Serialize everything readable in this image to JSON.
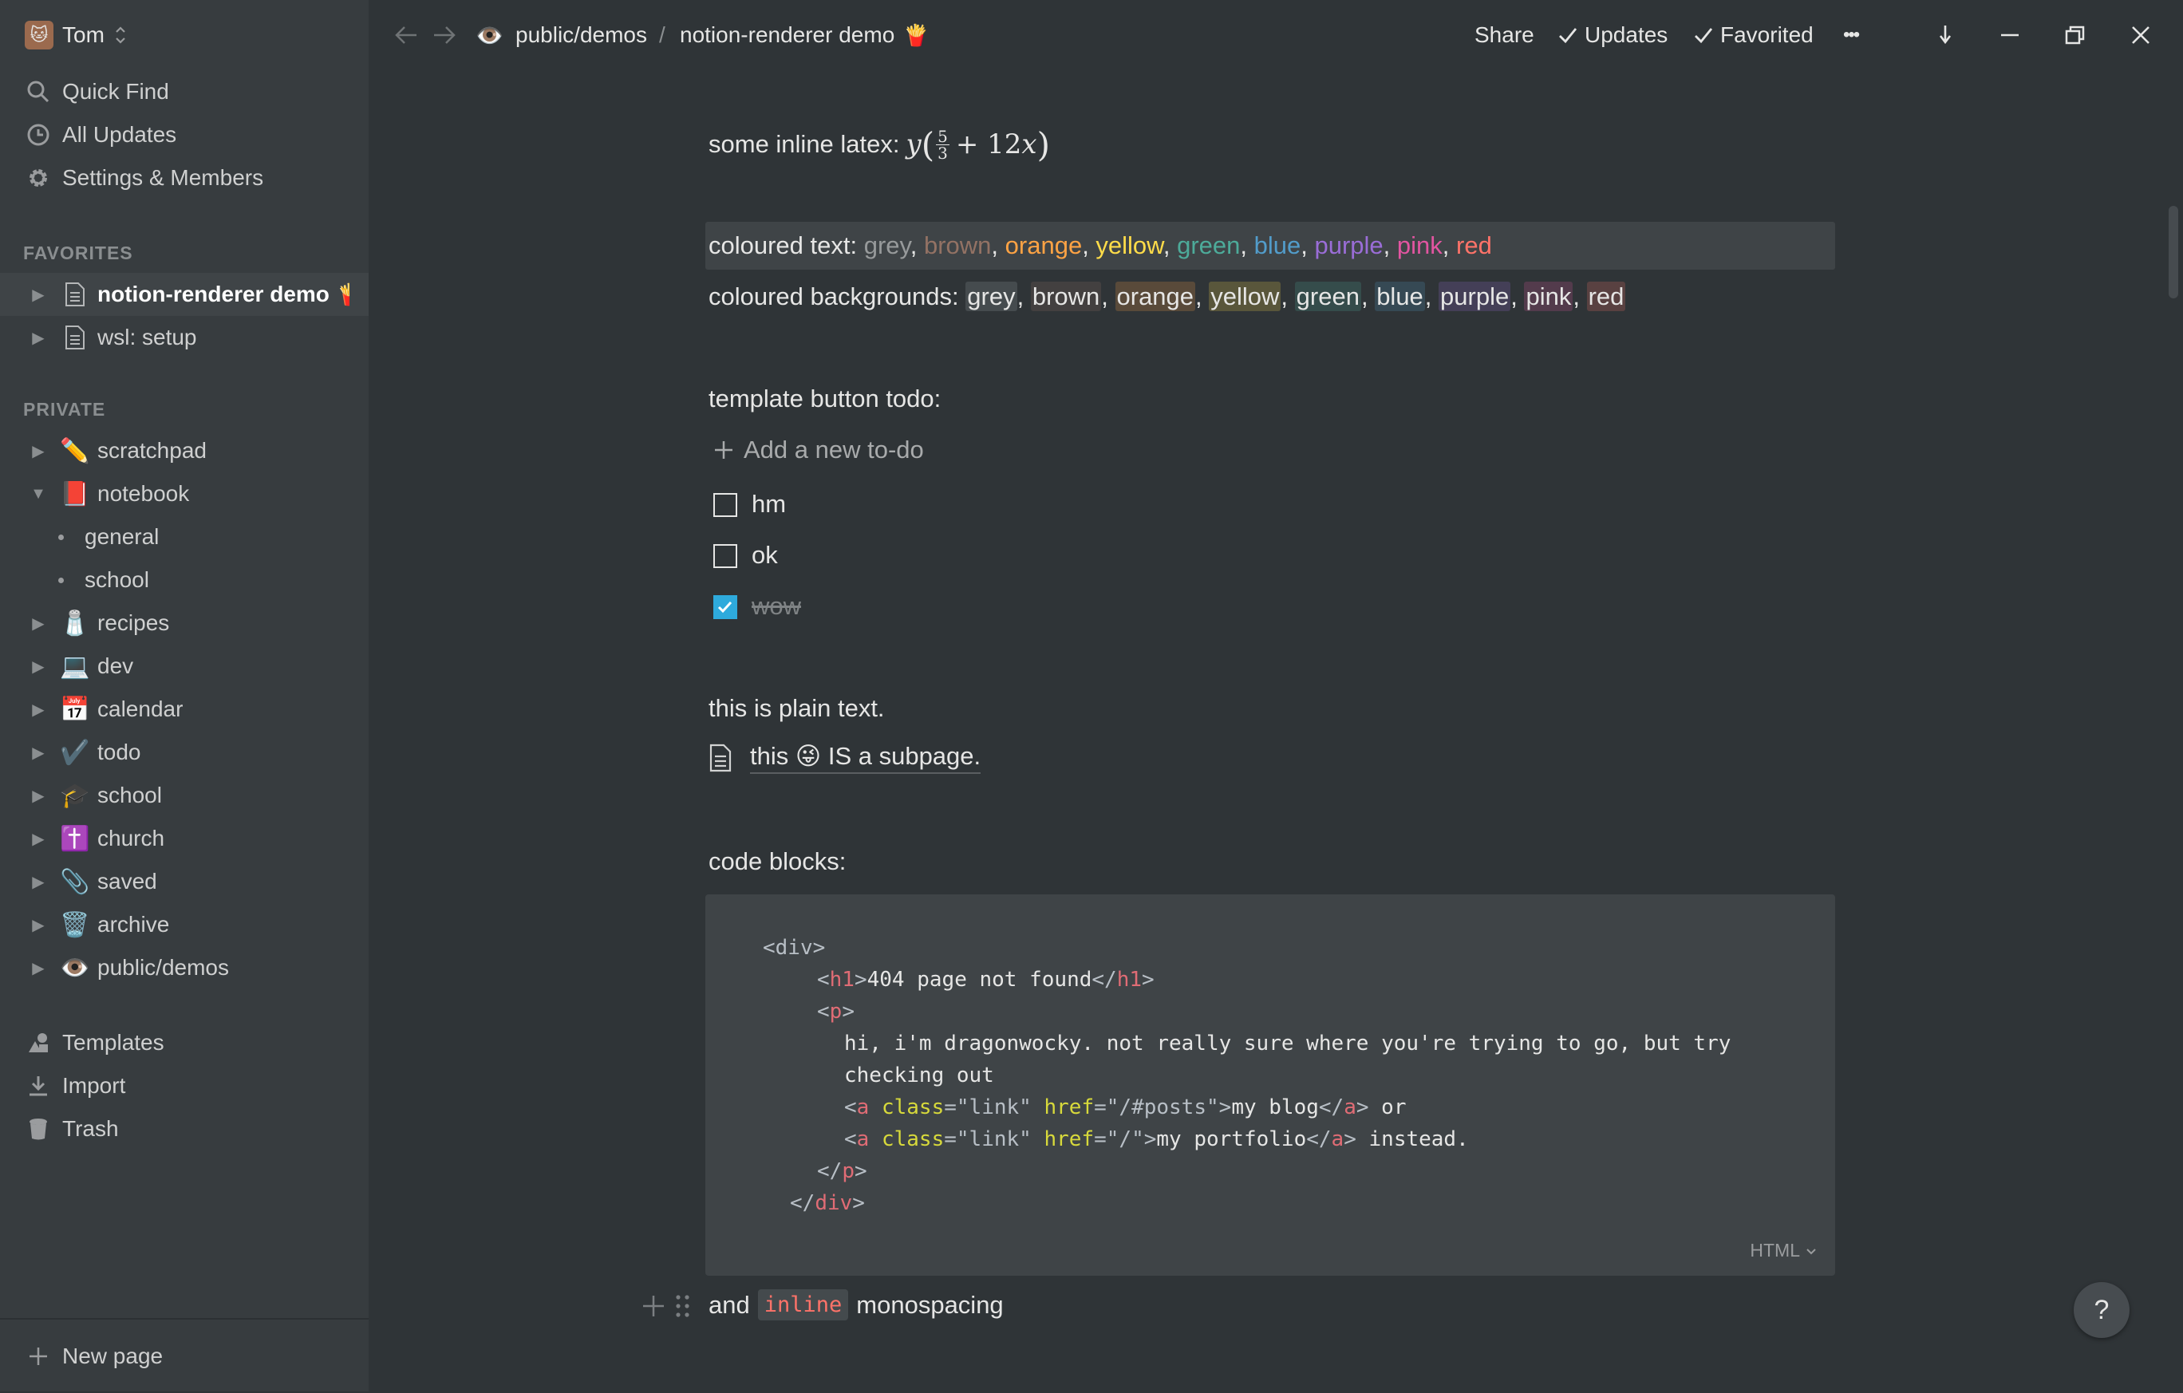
{
  "workspace": {
    "name": "Tom"
  },
  "sidebar": {
    "quick_find": "Quick Find",
    "all_updates": "All Updates",
    "settings": "Settings & Members",
    "favorites_label": "FAVORITES",
    "favorites": [
      {
        "label": "notion-renderer demo",
        "icon": "page-icon",
        "active": true
      },
      {
        "label": "wsl: setup",
        "icon": "page-icon"
      }
    ],
    "private_label": "PRIVATE",
    "private": [
      {
        "label": "scratchpad",
        "emoji": "✏️"
      },
      {
        "label": "notebook",
        "emoji": "📕",
        "expanded": true
      },
      {
        "label": "general",
        "child": true
      },
      {
        "label": "school",
        "child": true
      },
      {
        "label": "recipes",
        "emoji": "🧂"
      },
      {
        "label": "dev",
        "emoji": "💻"
      },
      {
        "label": "calendar",
        "emoji": "📅"
      },
      {
        "label": "todo",
        "emoji": "✔️"
      },
      {
        "label": "school",
        "emoji": "🎓"
      },
      {
        "label": "church",
        "emoji": "✝️"
      },
      {
        "label": "saved",
        "emoji": "📎"
      },
      {
        "label": "archive",
        "emoji": "🗑️"
      },
      {
        "label": "public/demos",
        "emoji": "👁️"
      }
    ],
    "templates": "Templates",
    "import": "Import",
    "trash": "Trash",
    "new_page": "New page"
  },
  "topbar": {
    "breadcrumb_parent": "public/demos",
    "breadcrumb_sep": "/",
    "breadcrumb_current": "notion-renderer demo",
    "breadcrumb_emoji": "🍟",
    "share": "Share",
    "updates": "Updates",
    "favorited": "Favorited",
    "more": "•••"
  },
  "content": {
    "latex_prefix": "some inline latex:",
    "latex": {
      "y": "y",
      "num": "5",
      "den": "3",
      "rest": "+ 12",
      "x": "x"
    },
    "coloured_text_label": "coloured text:",
    "coloured_bg_label": "coloured backgrounds:",
    "colours": [
      "grey",
      "brown",
      "orange",
      "yellow",
      "green",
      "blue",
      "purple",
      "pink",
      "red"
    ],
    "template_label": "template button todo:",
    "add_todo": "Add a new to-do",
    "todos": [
      {
        "text": "hm",
        "checked": false
      },
      {
        "text": "ok",
        "checked": false
      },
      {
        "text": "wow",
        "checked": true
      }
    ],
    "plain_text": "this is plain text.",
    "subpage": {
      "pre": "this",
      "emoji": "😜",
      "post": "IS a subpage."
    },
    "code_label": "code blocks:",
    "code_language": "HTML",
    "code": {
      "l1_open": "<div>",
      "l2_open": "<h1>",
      "l2_text": "404 page not found",
      "l2_close": "</h1>",
      "l3_open": "<p>",
      "l4_text": "hi, i'm dragonwocky. not really sure where you're trying to go, but try",
      "l5_text": "checking out",
      "a_open": "<a",
      "attr_class": "class",
      "eq": "=",
      "val_link": "\"link\"",
      "attr_href": "href",
      "val_posts": "\"/#posts\"",
      "gt": ">",
      "blog": "my blog",
      "a_close": "</a>",
      "or": " or",
      "val_root": "\"/\"",
      "portfolio": "my portfolio",
      "instead": " instead.",
      "l8_close": "</p>",
      "l9_close": "</div>"
    },
    "inline_pre": "and",
    "inline_code": "inline",
    "inline_post": "monospacing",
    "help": "?"
  }
}
